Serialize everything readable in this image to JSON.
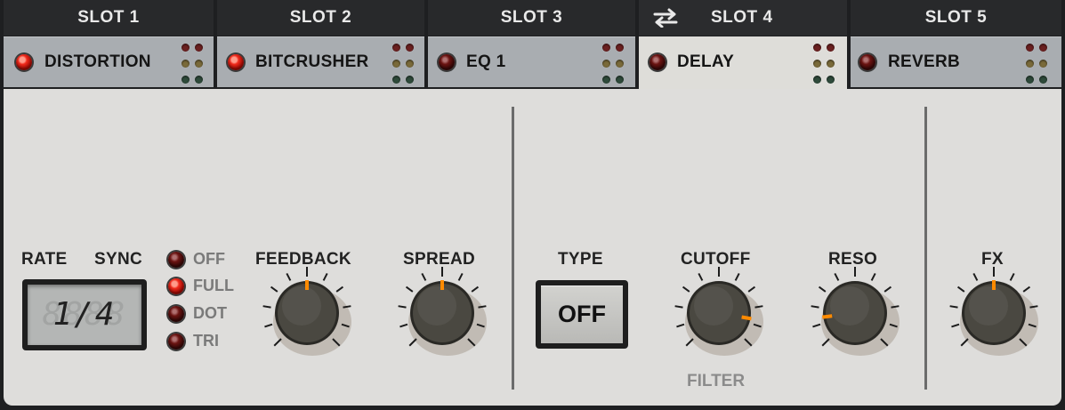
{
  "slots": [
    {
      "header": "SLOT 1",
      "name": "DISTORTION",
      "led": "on"
    },
    {
      "header": "SLOT 2",
      "name": "BITCRUSHER",
      "led": "on"
    },
    {
      "header": "SLOT 3",
      "name": "EQ 1",
      "led": "off"
    },
    {
      "header": "SLOT 4",
      "name": "DELAY",
      "led": "off",
      "active": true,
      "icon": "swap-arrows-icon"
    },
    {
      "header": "SLOT 5",
      "name": "REVERB",
      "led": "off"
    }
  ],
  "delay": {
    "rate_label": "RATE",
    "sync_label": "SYNC",
    "rate_value": "1/4",
    "sync_options": [
      {
        "label": "OFF",
        "selected": false
      },
      {
        "label": "FULL",
        "selected": true
      },
      {
        "label": "DOT",
        "selected": false
      },
      {
        "label": "TRI",
        "selected": false
      }
    ],
    "feedback_label": "FEEDBACK",
    "spread_label": "SPREAD",
    "type_label": "TYPE",
    "type_value": "OFF",
    "cutoff_label": "CUTOFF",
    "reso_label": "RESO",
    "filter_label": "FILTER",
    "fx_label": "FX"
  },
  "knob_values": {
    "feedback": 0.5,
    "spread": 0.5,
    "cutoff": 0.87,
    "reso": 0.14,
    "fx": 0.5
  },
  "colors": {
    "accent": "#ff8a00",
    "led_on": "#f02a1c",
    "led_off": "#6b1412",
    "panel": "#dedddb",
    "tab": "#a9adb1",
    "header": "#28292b"
  }
}
